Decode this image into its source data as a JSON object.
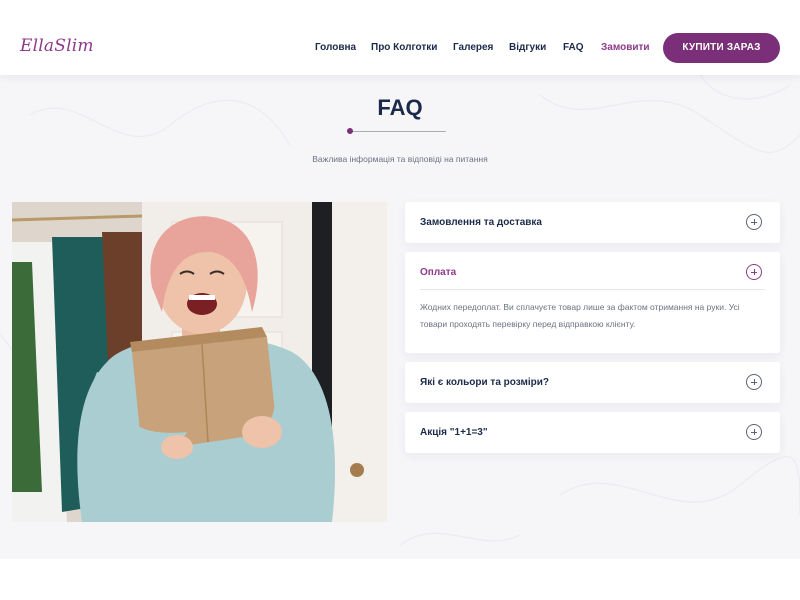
{
  "header": {
    "logo": "EllaSlim",
    "nav": [
      "Головна",
      "Про Колготки",
      "Галерея",
      "Відгуки",
      "FAQ",
      "Замовити"
    ],
    "cta": "КУПИТИ ЗАРАЗ"
  },
  "section": {
    "title": "FAQ",
    "subtitle": "Важлива інформація та відповіді на питання"
  },
  "faq": [
    {
      "question": "Замовлення та доставка",
      "open": false
    },
    {
      "question": "Оплата",
      "open": true,
      "answer": "Жодних передоплат. Ви сплачуєте товар лише за фактом отримання на руки. Усі товари проходять перевірку перед відправкою клієнту."
    },
    {
      "question": "Які є кольори та розміри?",
      "open": false
    },
    {
      "question": "Акція \"1+1=3\"",
      "open": false
    }
  ],
  "colors": {
    "brand": "#7a2f78",
    "accent_text": "#8e3a8a",
    "heading": "#1b2a4a",
    "section_bg": "#f6f6f9"
  },
  "icons": [
    "plus-circle-icon"
  ]
}
